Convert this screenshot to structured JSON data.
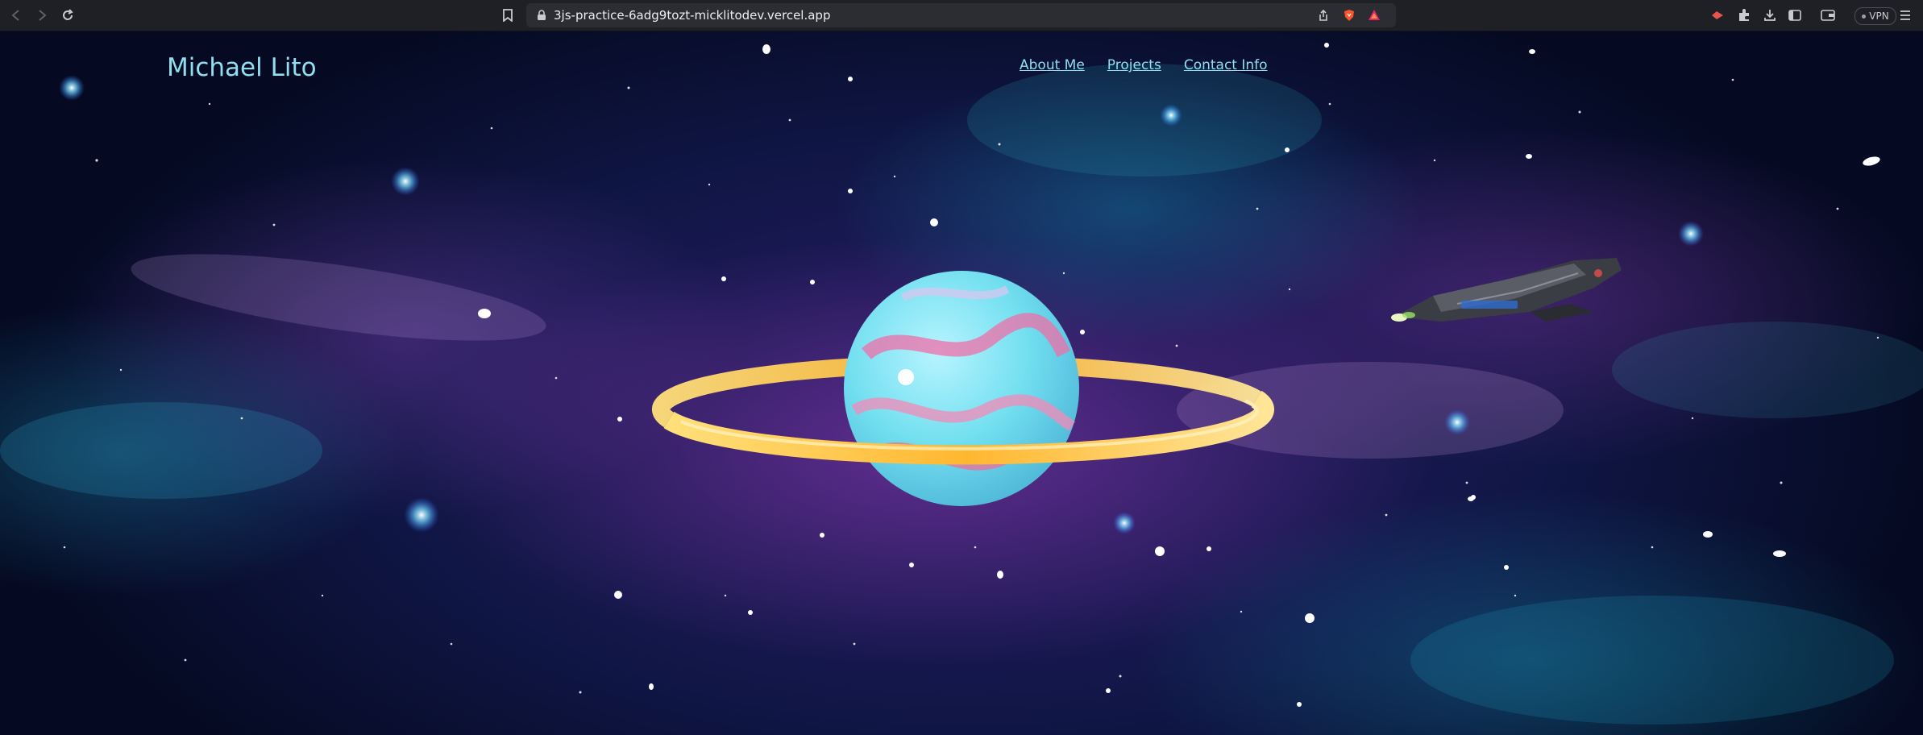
{
  "browser": {
    "url": "3js-practice-6adg9tozt-micklitodev.vercel.app",
    "vpn_label": "VPN"
  },
  "site": {
    "title": "Michael Lito",
    "nav": [
      {
        "label": "About Me"
      },
      {
        "label": "Projects"
      },
      {
        "label": "Contact Info"
      }
    ]
  },
  "colors": {
    "accent": "#8fdff0",
    "planet": "#7fe3f2",
    "ring": "#ffc84a"
  }
}
